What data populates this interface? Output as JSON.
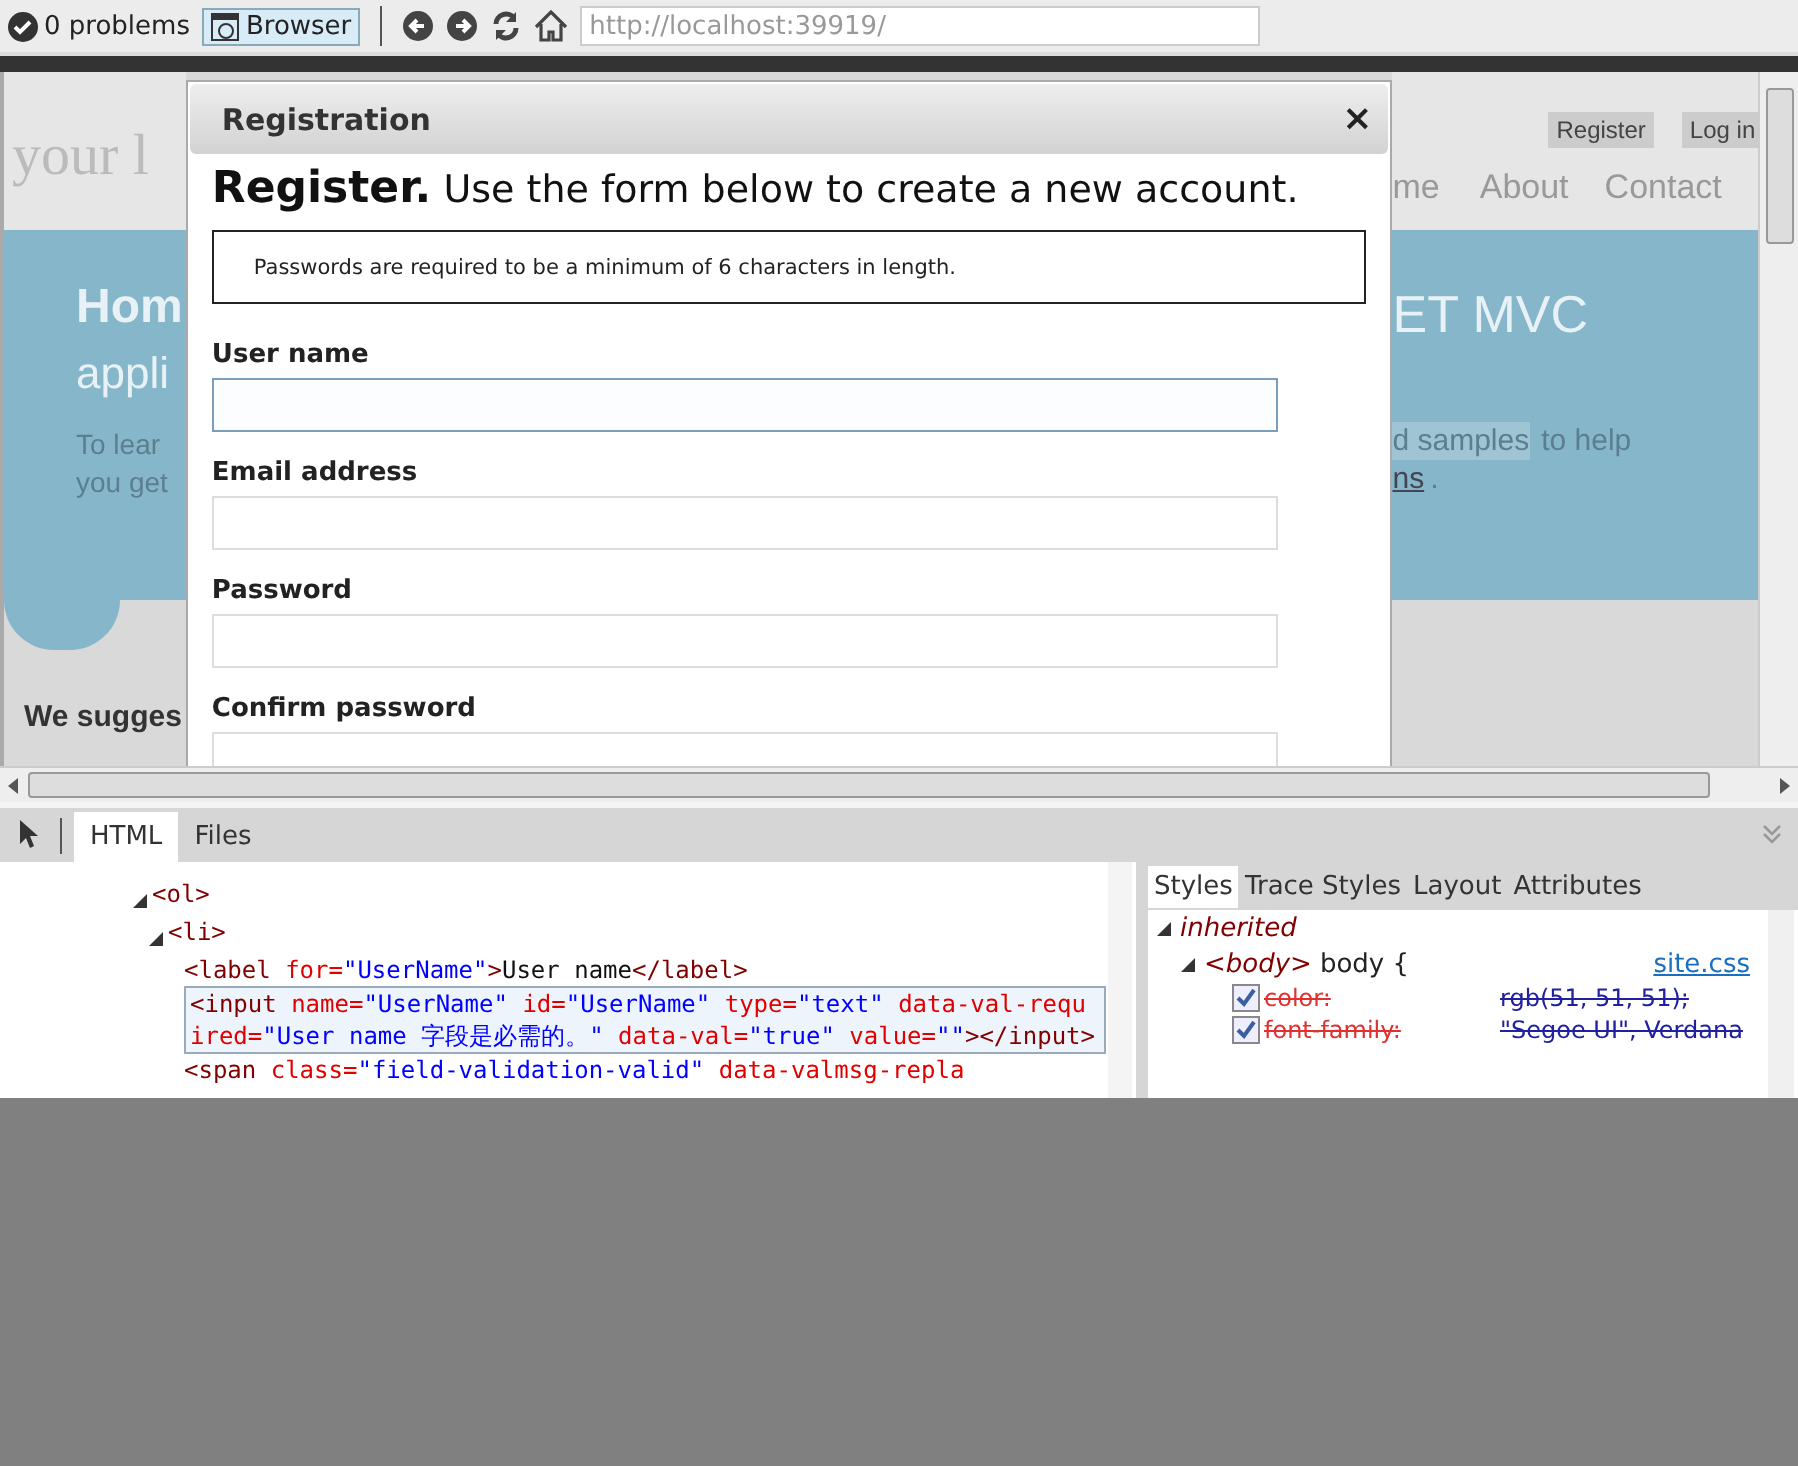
{
  "toolbar": {
    "problems": "0 problems",
    "browser_button": {
      "label": "Browser",
      "selected": true
    },
    "address": "http://localhost:39919/"
  },
  "page_left": {
    "logo": "your l",
    "hero_title": "Hom",
    "hero_subtitle": "appli",
    "hero_text": [
      "To lear",
      "you get"
    ],
    "section_heading": "We sugges"
  },
  "page_right": {
    "header_buttons": [
      "Register",
      "Log in"
    ],
    "nav": [
      "me",
      "About",
      "Contact"
    ],
    "hero_title": "ET MVC",
    "hero_line_1": {
      "highlight": "d samples",
      "rest": "to help"
    },
    "hero_line_2": {
      "link": "ns",
      "rest": "."
    }
  },
  "dialog": {
    "title": "Registration",
    "close": "×",
    "intro": "**Register.** Use the form below to create a new account.",
    "note": "Passwords are required to be a minimum of 6 characters in length.",
    "fields": [
      {
        "label": "User name",
        "focused": true
      },
      {
        "label": "Email address",
        "focused": false
      },
      {
        "label": "Password",
        "focused": false
      },
      {
        "label": "Confirm password",
        "focused": false
      }
    ]
  },
  "devtools": {
    "tabs": [
      {
        "label": "HTML",
        "selected": true
      },
      {
        "label": "Files",
        "selected": false
      }
    ],
    "dom_tree": [
      {
        "expanded": true,
        "selected": false,
        "tokens": [
          {
            "kind": "tag",
            "text": "<ol>"
          }
        ],
        "children": [
          {
            "expanded": true,
            "selected": false,
            "tokens": [
              {
                "kind": "tag",
                "text": "<li>"
              }
            ],
            "children": [
              {
                "selected": false,
                "tokens": [
                  {
                    "kind": "tag",
                    "text": "<label "
                  },
                  {
                    "kind": "attr",
                    "text": "for="
                  },
                  {
                    "kind": "value",
                    "text": "\"UserName\""
                  },
                  {
                    "kind": "tag",
                    "text": ">"
                  },
                  {
                    "kind": "text",
                    "text": "User name"
                  },
                  {
                    "kind": "tag",
                    "text": "</label>"
                  }
                ]
              },
              {
                "selected": true,
                "tokens": [
                  {
                    "kind": "tag",
                    "text": "<input "
                  },
                  {
                    "kind": "attr",
                    "text": "name="
                  },
                  {
                    "kind": "value",
                    "text": "\"UserName\" "
                  },
                  {
                    "kind": "attr",
                    "text": "id="
                  },
                  {
                    "kind": "value",
                    "text": "\"UserName\" "
                  },
                  {
                    "kind": "attr",
                    "text": "type="
                  },
                  {
                    "kind": "value",
                    "text": "\"text\" "
                  },
                  {
                    "kind": "attr",
                    "text": "data-val-required="
                  },
                  {
                    "kind": "value",
                    "text": "\"User name 字段是必需的。\" "
                  },
                  {
                    "kind": "attr",
                    "text": "data-val="
                  },
                  {
                    "kind": "value",
                    "text": "\"true\" "
                  },
                  {
                    "kind": "attr",
                    "text": "value="
                  },
                  {
                    "kind": "value",
                    "text": "\"\""
                  },
                  {
                    "kind": "tag",
                    "text": "></input>"
                  }
                ]
              },
              {
                "selected": false,
                "tokens": [
                  {
                    "kind": "tag",
                    "text": "<span "
                  },
                  {
                    "kind": "attr",
                    "text": "class="
                  },
                  {
                    "kind": "value",
                    "text": "\"field-validation-valid\" "
                  },
                  {
                    "kind": "attr",
                    "text": "data-valmsg-repla"
                  }
                ]
              }
            ]
          }
        ]
      }
    ],
    "style_tabs": [
      {
        "label": "Styles",
        "selected": true
      },
      {
        "label": "Trace Styles",
        "selected": false
      },
      {
        "label": "Layout",
        "selected": false
      },
      {
        "label": "Attributes",
        "selected": false
      }
    ],
    "styles": {
      "section": "inherited",
      "expanded": true,
      "rule": {
        "element": "<body>",
        "selector": "body {",
        "source": "site.css",
        "expanded": true,
        "properties": [
          {
            "name": "color:",
            "value": "rgb(51, 51, 51);",
            "checked": true,
            "overridden": true
          },
          {
            "name": "font-family:",
            "value": "\"Segoe UI\", Verdana",
            "checked": true,
            "overridden": true
          }
        ]
      }
    }
  }
}
